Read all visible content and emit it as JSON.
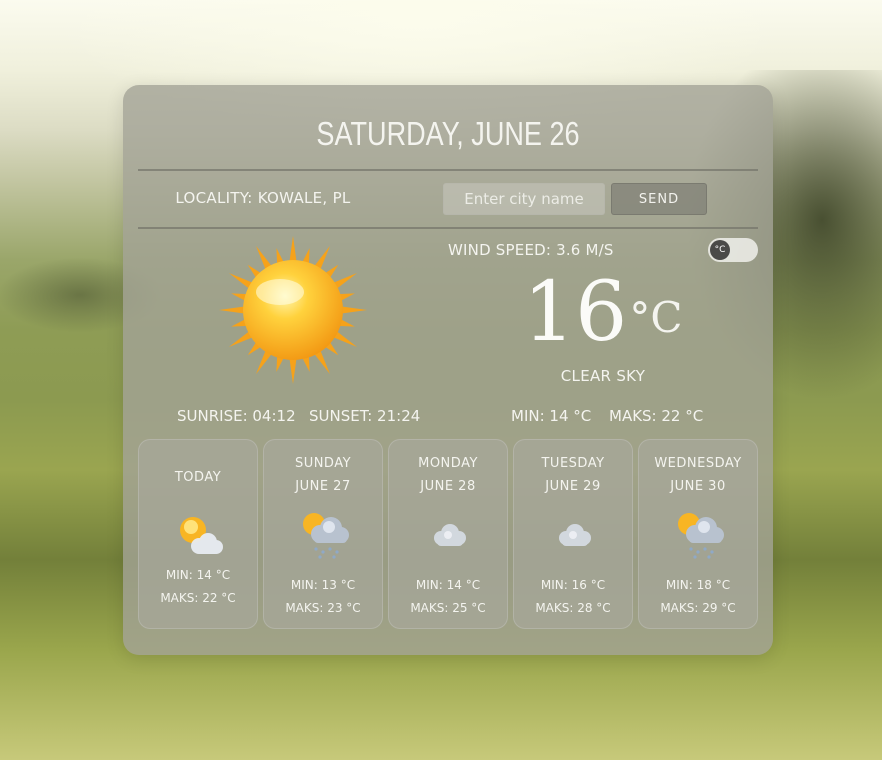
{
  "header": {
    "date": "SATURDAY, JUNE 26"
  },
  "search": {
    "locality": "LOCALITY: KOWALE, PL",
    "placeholder": "Enter city name",
    "value": "",
    "send_label": "SEND"
  },
  "current": {
    "icon": "sun-icon",
    "wind": "WIND SPEED: 3.6 M/S",
    "unit_toggle": "°C",
    "temp": "16",
    "unit": "°C",
    "description": "CLEAR SKY",
    "sunrise": "SUNRISE: 04:12",
    "sunset": "SUNSET: 21:24",
    "min": "MIN: 14 °C",
    "max": "MAKS: 22 °C"
  },
  "forecast": [
    {
      "name": "TODAY",
      "date": "",
      "icon": "sun-behind-cloud-icon",
      "min": "MIN: 14 °C",
      "max": "MAKS: 22 °C"
    },
    {
      "name": "SUNDAY",
      "date": "JUNE 27",
      "icon": "sun-cloud-rain-icon",
      "min": "MIN: 13 °C",
      "max": "MAKS: 23 °C"
    },
    {
      "name": "MONDAY",
      "date": "JUNE 28",
      "icon": "cloud-icon",
      "min": "MIN: 14 °C",
      "max": "MAKS: 25 °C"
    },
    {
      "name": "TUESDAY",
      "date": "JUNE 29",
      "icon": "cloud-icon",
      "min": "MIN: 16 °C",
      "max": "MAKS: 28 °C"
    },
    {
      "name": "WEDNESDAY",
      "date": "JUNE 30",
      "icon": "sun-cloud-rain-icon",
      "min": "MIN: 18 °C",
      "max": "MAKS: 29 °C"
    }
  ],
  "colors": {
    "card": "#a2a296",
    "text": "#f4f4ef",
    "sun": "#f7a31b"
  }
}
